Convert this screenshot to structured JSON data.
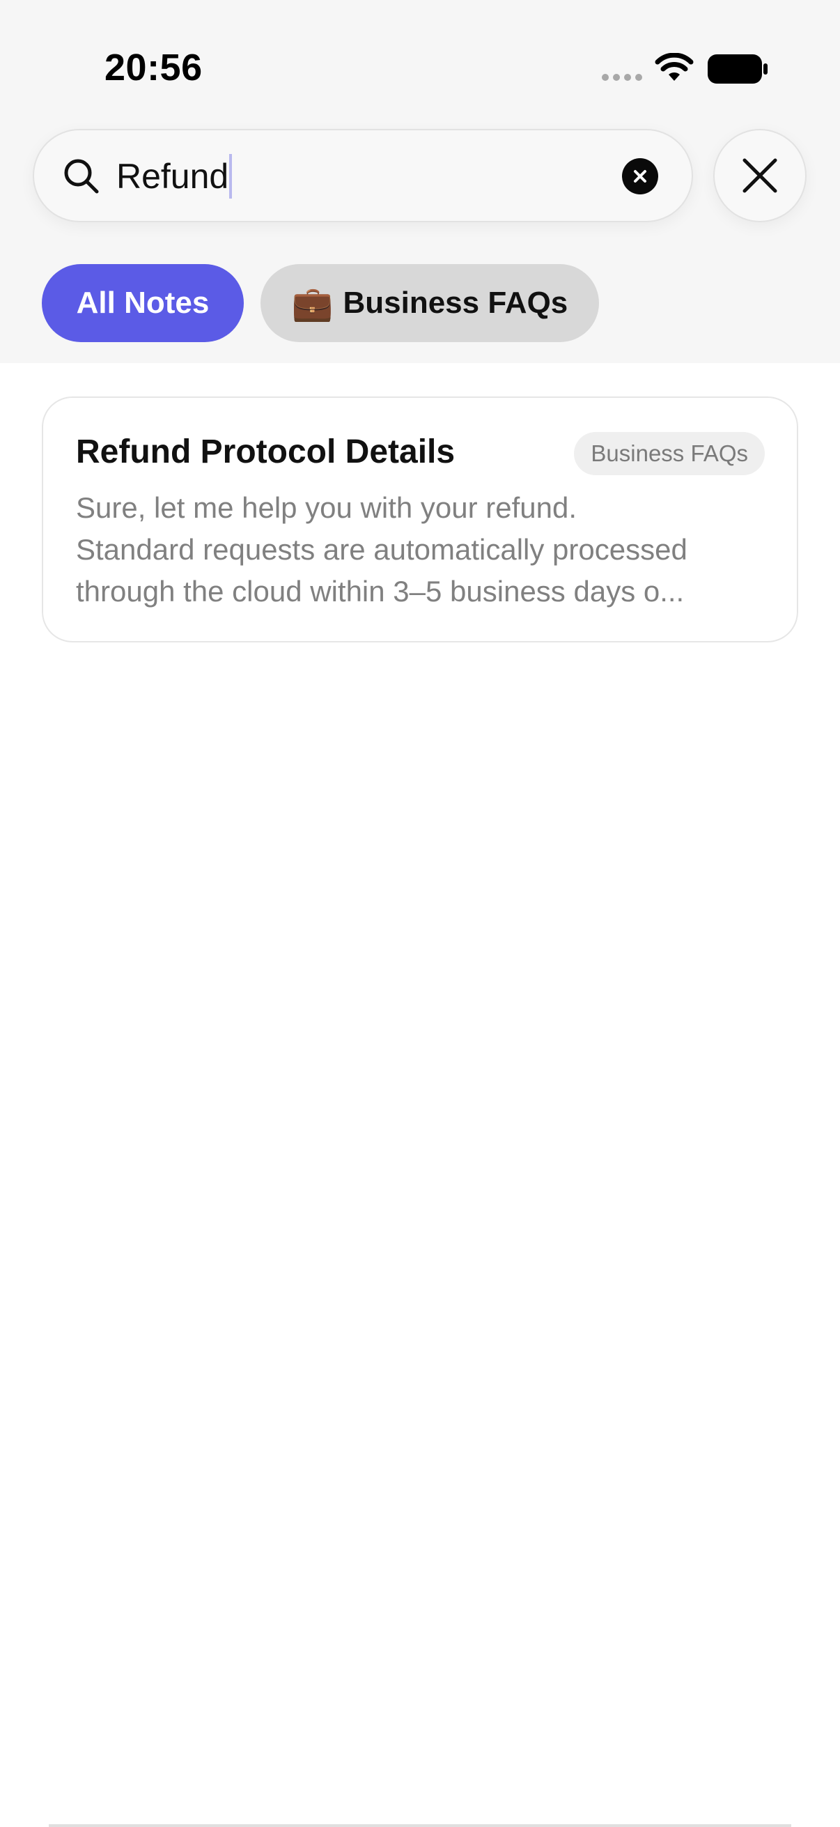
{
  "status_bar": {
    "time": "20:56",
    "icons": [
      "signal-dots-icon",
      "wifi-icon",
      "battery-icon"
    ]
  },
  "search": {
    "value": "Refund",
    "icon": "search-icon",
    "clear_icon": "clear-icon",
    "close_icon": "close-icon"
  },
  "filters": [
    {
      "label": "All Notes",
      "selected": true
    },
    {
      "emoji": "💼",
      "label": "Business FAQs",
      "selected": false
    }
  ],
  "results": [
    {
      "title": "Refund Protocol Details",
      "badge": "Business FAQs",
      "snippet_lines": [
        "Sure, let me help you with your refund.",
        "Standard requests are automatically processed",
        "through the cloud within 3–5 business days o..."
      ]
    }
  ],
  "colors": {
    "accent": "#5b5be6",
    "chip_inactive": "#d8d8d8",
    "background_top": "#f6f6f6",
    "snippet_text": "#808080"
  }
}
